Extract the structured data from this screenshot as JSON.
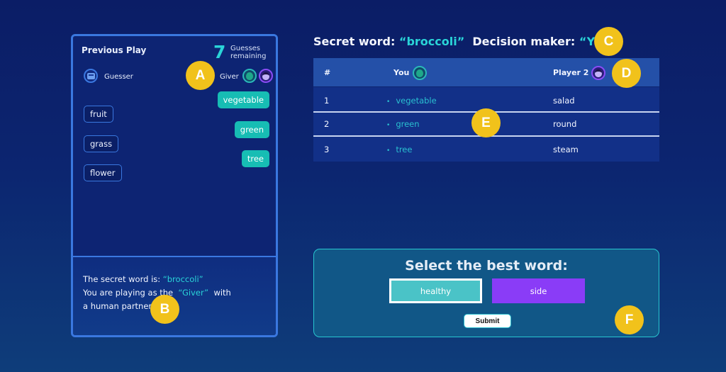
{
  "left_panel": {
    "title": "Previous Play",
    "guesses_remaining_count": "7",
    "guesses_remaining_label_line1": "Guesses",
    "guesses_remaining_label_line2": "remaining",
    "guesser_label": "Guesser",
    "giver_label": "Giver",
    "guesser_words": [
      "fruit",
      "grass",
      "flower"
    ],
    "giver_clues": [
      "vegetable",
      "green",
      "tree"
    ],
    "info": {
      "line1_prefix": "The secret word is:",
      "line1_value": "“broccoli”",
      "line2_prefix": "You are playing as the",
      "line2_value": "“Giver”",
      "line2_suffix": "with",
      "line3": "a human partner"
    }
  },
  "header": {
    "secret_label": "Secret word:",
    "secret_value": "“broccoli”",
    "decision_label": "Decision maker:",
    "decision_value": "“You”"
  },
  "table": {
    "columns": [
      "#",
      "You",
      "Player 2"
    ],
    "rows": [
      {
        "num": "1",
        "you": "vegetable",
        "player2": "salad"
      },
      {
        "num": "2",
        "you": "green",
        "player2": "round"
      },
      {
        "num": "3",
        "you": "tree",
        "player2": "steam"
      }
    ]
  },
  "selection": {
    "title": "Select the best word:",
    "options": [
      "healthy",
      "side"
    ],
    "selected": "healthy",
    "submit_label": "Submit"
  },
  "markers": [
    "A",
    "B",
    "C",
    "D",
    "E",
    "F"
  ],
  "colors": {
    "accent_teal": "#2ad4d8",
    "clue_chip": "#17bdb4",
    "option_selected": "#4ac3c7",
    "option_alt": "#8a3cf7",
    "marker": "#f1c21b"
  }
}
